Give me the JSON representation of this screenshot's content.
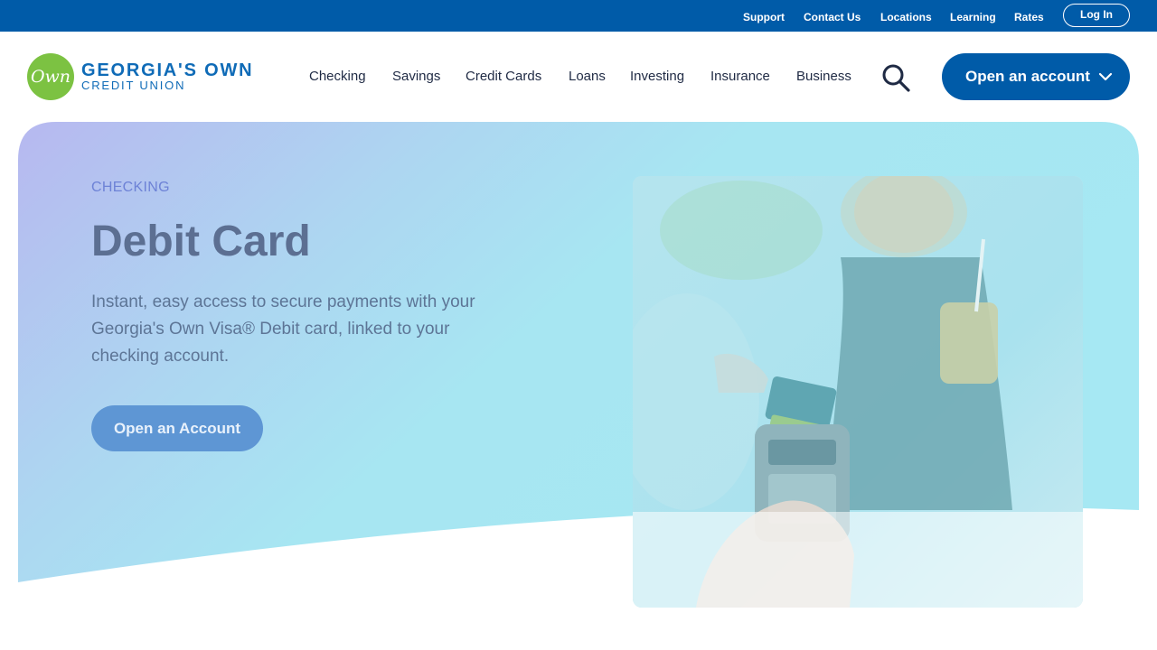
{
  "utility_nav": {
    "links": [
      "Support",
      "Contact Us",
      "Locations",
      "Learning",
      "Rates"
    ],
    "login_label": "Log In"
  },
  "brand": {
    "logo_mark": "Own",
    "name_line1": "GEORGIA'S OWN",
    "name_line2": "CREDIT UNION",
    "colors": {
      "primary": "#005ba8",
      "logo_green": "#7cc242"
    }
  },
  "main_nav": {
    "items": [
      "Checking",
      "Savings",
      "Credit Cards",
      "Loans",
      "Investing",
      "Insurance",
      "Business"
    ],
    "search_icon": "search-icon",
    "cta_label": "Open an account",
    "cta_icon": "chevron-down-icon"
  },
  "hero": {
    "eyebrow": "CHECKING",
    "title": "Debit Card",
    "description": "Instant, easy access to secure payments with your Georgia's Own Visa® Debit card, linked to your checking account.",
    "button_label": "Open an Account"
  }
}
